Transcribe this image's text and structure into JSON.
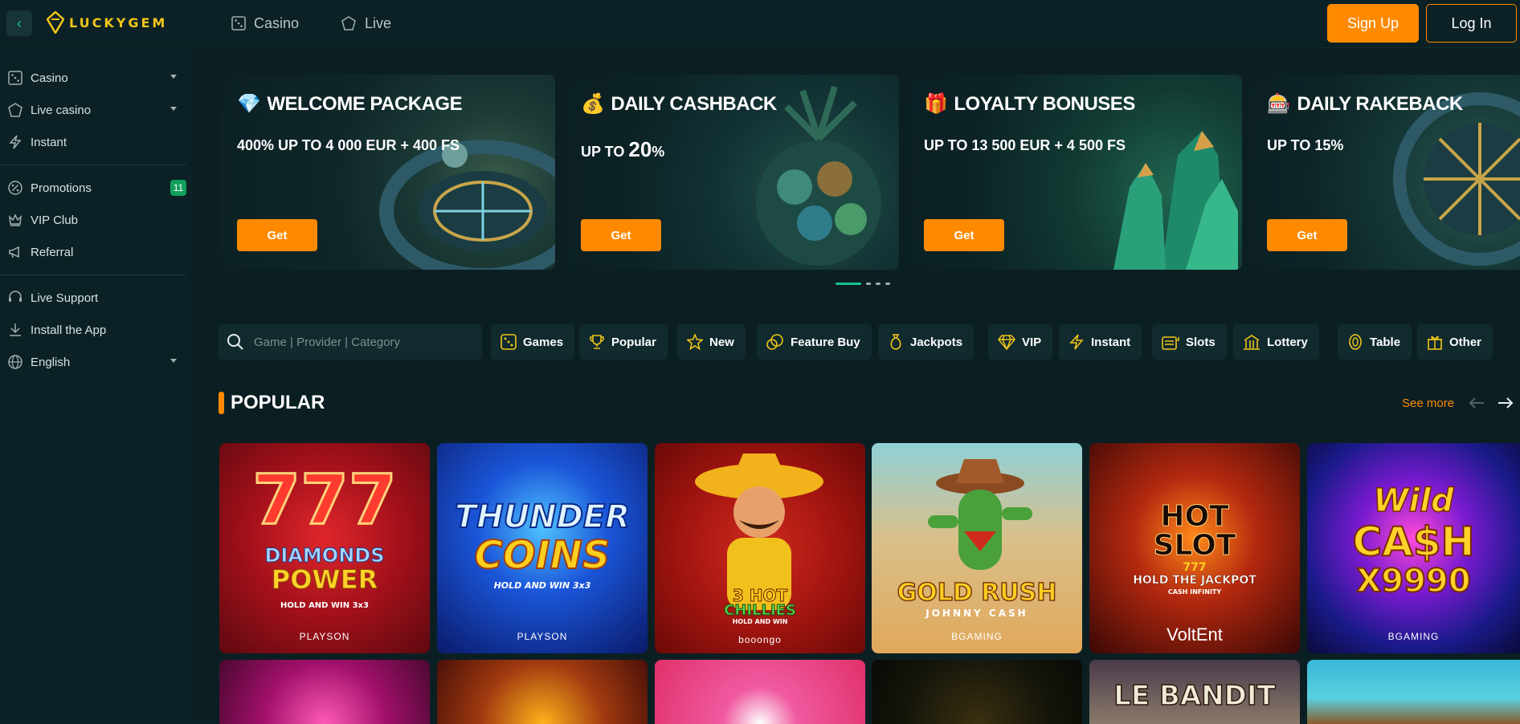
{
  "header": {
    "logo_text": "LUCKYGEM",
    "nav": [
      {
        "label": "Casino",
        "icon": "dice-icon"
      },
      {
        "label": "Live",
        "icon": "chip-icon"
      }
    ],
    "signup_label": "Sign Up",
    "login_label": "Log In"
  },
  "sidebar": {
    "items": [
      {
        "label": "Casino",
        "icon": "dice-icon",
        "caret": true
      },
      {
        "label": "Live casino",
        "icon": "chip-icon",
        "caret": true
      },
      {
        "label": "Instant",
        "icon": "lightning-icon"
      },
      {
        "label": "Promotions",
        "icon": "percent-icon",
        "badge": "11"
      },
      {
        "label": "VIP Club",
        "icon": "crown-icon"
      },
      {
        "label": "Referral",
        "icon": "megaphone-icon"
      },
      {
        "label": "Live Support",
        "icon": "headset-icon"
      },
      {
        "label": "Install the App",
        "icon": "download-icon"
      },
      {
        "label": "English",
        "icon": "globe-icon",
        "caret": true
      }
    ]
  },
  "promos": [
    {
      "title": "WELCOME PACKAGE",
      "emoji": "💎",
      "subtitle": "400% UP TO 4 000 EUR + 400 FS",
      "button": "Get"
    },
    {
      "title": "DAILY CASHBACK",
      "emoji": "💰",
      "subtitle_prefix": "UP TO ",
      "subtitle_big": "20",
      "subtitle_suffix": "%",
      "button": "Get"
    },
    {
      "title": "LOYALTY BONUSES",
      "emoji": "🎁",
      "subtitle": "UP TO 13 500 EUR + 4 500 FS",
      "button": "Get"
    },
    {
      "title": "DAILY RAKEBACK",
      "emoji": "🎰",
      "subtitle": "UP TO 15%",
      "button": "Get"
    }
  ],
  "search": {
    "placeholder": "Game | Provider | Category"
  },
  "categories": [
    "Games",
    "Popular",
    "New",
    "Feature Buy",
    "Jackpots",
    "VIP",
    "Instant",
    "Slots",
    "Lottery",
    "Table",
    "Other"
  ],
  "section": {
    "title": "POPULAR",
    "see_more": "See more"
  },
  "games": [
    {
      "line1": "777",
      "line2": "DIAMONDS",
      "line3": "POWER",
      "line4": "HOLD AND WIN 3x3",
      "provider": "PLAYSON"
    },
    {
      "line1": "THUNDER",
      "line2": "COINS",
      "line3": "HOLD AND WIN 3x3",
      "provider": "PLAYSON"
    },
    {
      "line1": "3 HOT",
      "line2": "CHILLIES",
      "line3": "HOLD AND WIN",
      "provider": "booongo"
    },
    {
      "line1": "GOLD RUSH",
      "line2": "JOHNNY CASH",
      "provider": "BGAMING"
    },
    {
      "line1": "HOT",
      "line2": "SLOT",
      "line3": "777",
      "line4": "HOLD THE JACKPOT",
      "line5": "CASH INFINITY",
      "provider": "VoltEnt"
    },
    {
      "line1": "Wild",
      "line2": "CA$H",
      "line3": "X9990",
      "provider": "BGAMING"
    }
  ],
  "games_row2": [
    {
      "title": ""
    },
    {
      "title": ""
    },
    {
      "title": ""
    },
    {
      "title": ""
    },
    {
      "title": "LE BANDIT"
    },
    {
      "title": ""
    }
  ]
}
